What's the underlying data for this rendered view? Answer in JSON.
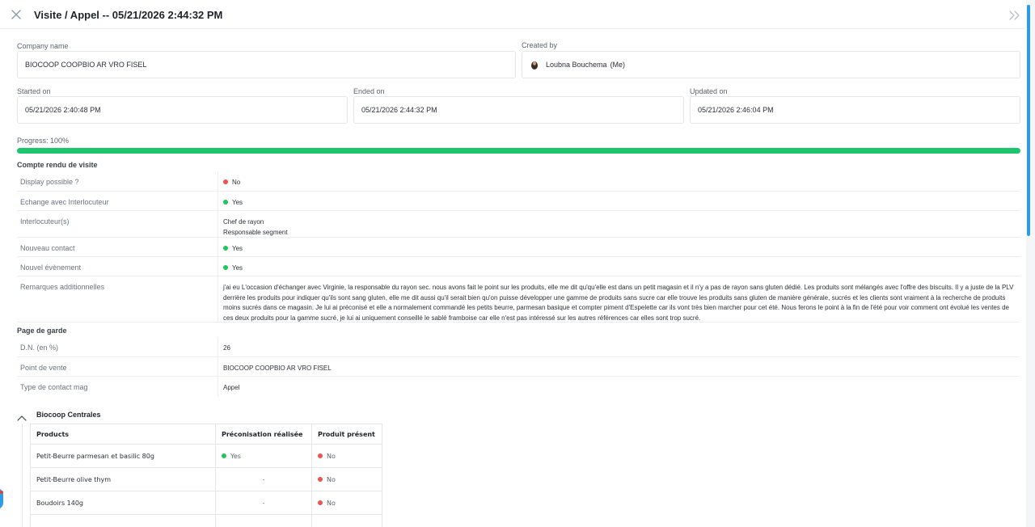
{
  "header": {
    "title": "Visite / Appel -- 05/21/2026 2:44:32 PM"
  },
  "icons": {
    "close": "close-icon",
    "expand": "double-chevron-right-icon",
    "collapse": "chevron-up-icon"
  },
  "colors": {
    "progress": "#1dc56c",
    "yes": "#22c55e",
    "no": "#ef5350",
    "accent": "#2f9be6"
  },
  "company": {
    "label": "Company name",
    "value": "BIOCOOP COOPBIO AR VRO FISEL"
  },
  "created_by": {
    "label": "Created by",
    "value": "Loubna Bouchema",
    "suffix": "(Me)"
  },
  "started": {
    "label": "Started on",
    "value": "05/21/2026 2:40:48 PM"
  },
  "ended": {
    "label": "Ended on",
    "value": "05/21/2026 2:44:32 PM"
  },
  "updated": {
    "label": "Updated on",
    "value": "05/21/2026 2:46:04 PM"
  },
  "progress": {
    "label": "Progress: 100%",
    "value": 1.0
  },
  "compte_rendu": {
    "title": "Compte rendu de visite",
    "rows": [
      {
        "key": "Display possible ?",
        "value": "No",
        "status": "no"
      },
      {
        "key": "Echange avec Interlocuteur",
        "value": "Yes",
        "status": "yes"
      },
      {
        "key": "Interlocuteur(s)",
        "lines": [
          "Chef de rayon",
          "Responsable segment"
        ]
      },
      {
        "key": "Nouveau contact",
        "value": "Yes",
        "status": "yes"
      },
      {
        "key": "Nouvel évènement",
        "value": "Yes",
        "status": "yes"
      },
      {
        "key": "Remarques additionnelles",
        "value": "j'ai eu L'occasion d'échanger avec Virginie, la responsable du rayon sec. nous avons fait le point sur les produits, elle me dit qu'qu'elle est dans un petit magasin et il n'y a pas de rayon sans gluten dédié. Les produits sont mélangés avec l'offre des biscuits. Il y a juste de la PLV derrière les produits pour indiquer qu'ils sont sang gluten, elle me dit aussi qu'il serait bien qu'on puisse développer une gamme de produits sans sucre car elle trouve les produits sans gluten de manière générale, sucrés et les clients sont vraiment à la recherche de produits moins sucrés dans ce magasin. Je lui ai préconisé et elle a normalement commandé les petits beurre, parmesan basique et compter piment d'Espelette car ils vont très bien marcher pour cet été. Nous ferons le point à la fin de l'été pour voir comment ont évolué les ventes de ces deux produits pour la gamme sucré, je lui ai uniquement conseillé le sablé framboise car elle n'est pas intéressé sur les autres références car elles sont trop sucré."
      }
    ]
  },
  "page_de_garde": {
    "title": "Page de garde",
    "rows": [
      {
        "key": "D.N. (en %)",
        "value": "26"
      },
      {
        "key": "Point de vente",
        "value": "BIOCOOP COOPBIO AR VRO FISEL"
      },
      {
        "key": "Type de contact mag",
        "value": "Appel"
      }
    ]
  },
  "centrales": {
    "title": "Biocoop Centrales",
    "columns": [
      "Products",
      "Préconisation réalisée",
      "Produit présent"
    ],
    "rows": [
      {
        "product": "Petit-Beurre parmesan et basilic 80g",
        "preco": "Yes",
        "preco_status": "yes",
        "present": "No",
        "present_status": "no"
      },
      {
        "product": "Petit-Beurre olive thym",
        "preco": "-",
        "preco_status": "",
        "present": "No",
        "present_status": "no"
      },
      {
        "product": "Boudoirs 140g",
        "preco": "-",
        "preco_status": "",
        "present": "No",
        "present_status": "no"
      }
    ]
  }
}
